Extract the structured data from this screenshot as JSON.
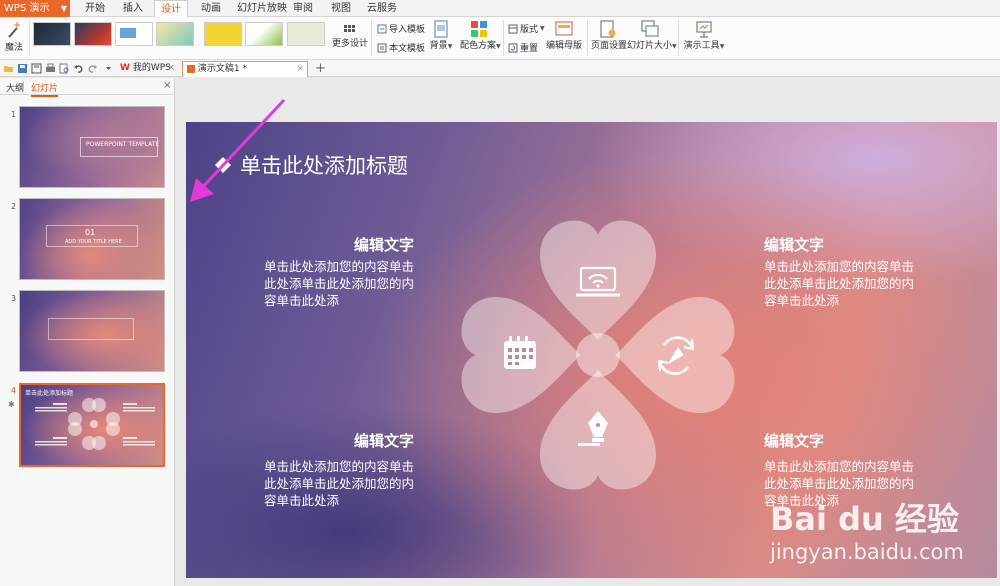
{
  "menubar": {
    "app_label": "WPS 演示",
    "tabs": [
      "开始",
      "插入",
      "设计",
      "动画",
      "幻灯片放映",
      "审阅",
      "视图",
      "云服务"
    ],
    "active_tab": "设计"
  },
  "ribbon": {
    "magic_label": "魔法",
    "more_designs_label": "更多设计",
    "import_template_label": "导入模板",
    "text_template_label": "本文模板",
    "background_label": "背景",
    "color_scheme_label": "配色方案",
    "layout_label": "版式",
    "reset_label": "重置",
    "edit_master_label": "编辑母版",
    "page_setup_label": "页面设置",
    "slide_size_label": "幻灯片大小",
    "presentation_tools_label": "演示工具"
  },
  "tabbar": {
    "tabs": [
      {
        "label": "我的WPS",
        "active": false
      },
      {
        "label": "演示文稿1 *",
        "active": true
      }
    ],
    "new_tab": "+"
  },
  "panel": {
    "tabs": [
      "大纲",
      "幻灯片"
    ],
    "active_tab": "幻灯片",
    "close": "×",
    "slides": [
      {
        "number": "1",
        "caption": "POWERPOINT TEMPLATE"
      },
      {
        "number": "2",
        "caption_big": "01",
        "caption": "ADD YOUR TITLE HERE"
      },
      {
        "number": "3",
        "caption": ""
      },
      {
        "number": "4",
        "caption": "单击此处添加标题",
        "current": true
      }
    ],
    "star": "✱"
  },
  "slide": {
    "heading": "单击此处添加标题",
    "blocks": [
      {
        "title": "编辑文字",
        "lines": [
          "单击此处添加您的内容单击",
          "此处添单击此处添加您的内",
          "容单击此处添"
        ]
      },
      {
        "title": "编辑文字",
        "lines": [
          "单击此处添加您的内容单击",
          "此处添单击此处添加您的内",
          "容单击此处添"
        ]
      },
      {
        "title": "编辑文字",
        "lines": [
          "单击此处添加您的内容单击",
          "此处添单击此处添加您的内",
          "容单击此处添"
        ]
      },
      {
        "title": "编辑文字",
        "lines": [
          "单击此处添加您的内容单击",
          "此处添单击此处添加您的内",
          "容单击此处添"
        ]
      }
    ]
  },
  "watermark": {
    "brand": "Bai du 经验",
    "url": "jingyan.baidu.com"
  },
  "colors": {
    "accent": "#e8682a",
    "annotation_arrow": "#e23ad8"
  },
  "icons": [
    "magic-wand-icon",
    "laptop-wifi-icon",
    "calendar-icon",
    "refresh-cycle-icon",
    "pen-nib-icon",
    "diamond-bullet-icon"
  ]
}
